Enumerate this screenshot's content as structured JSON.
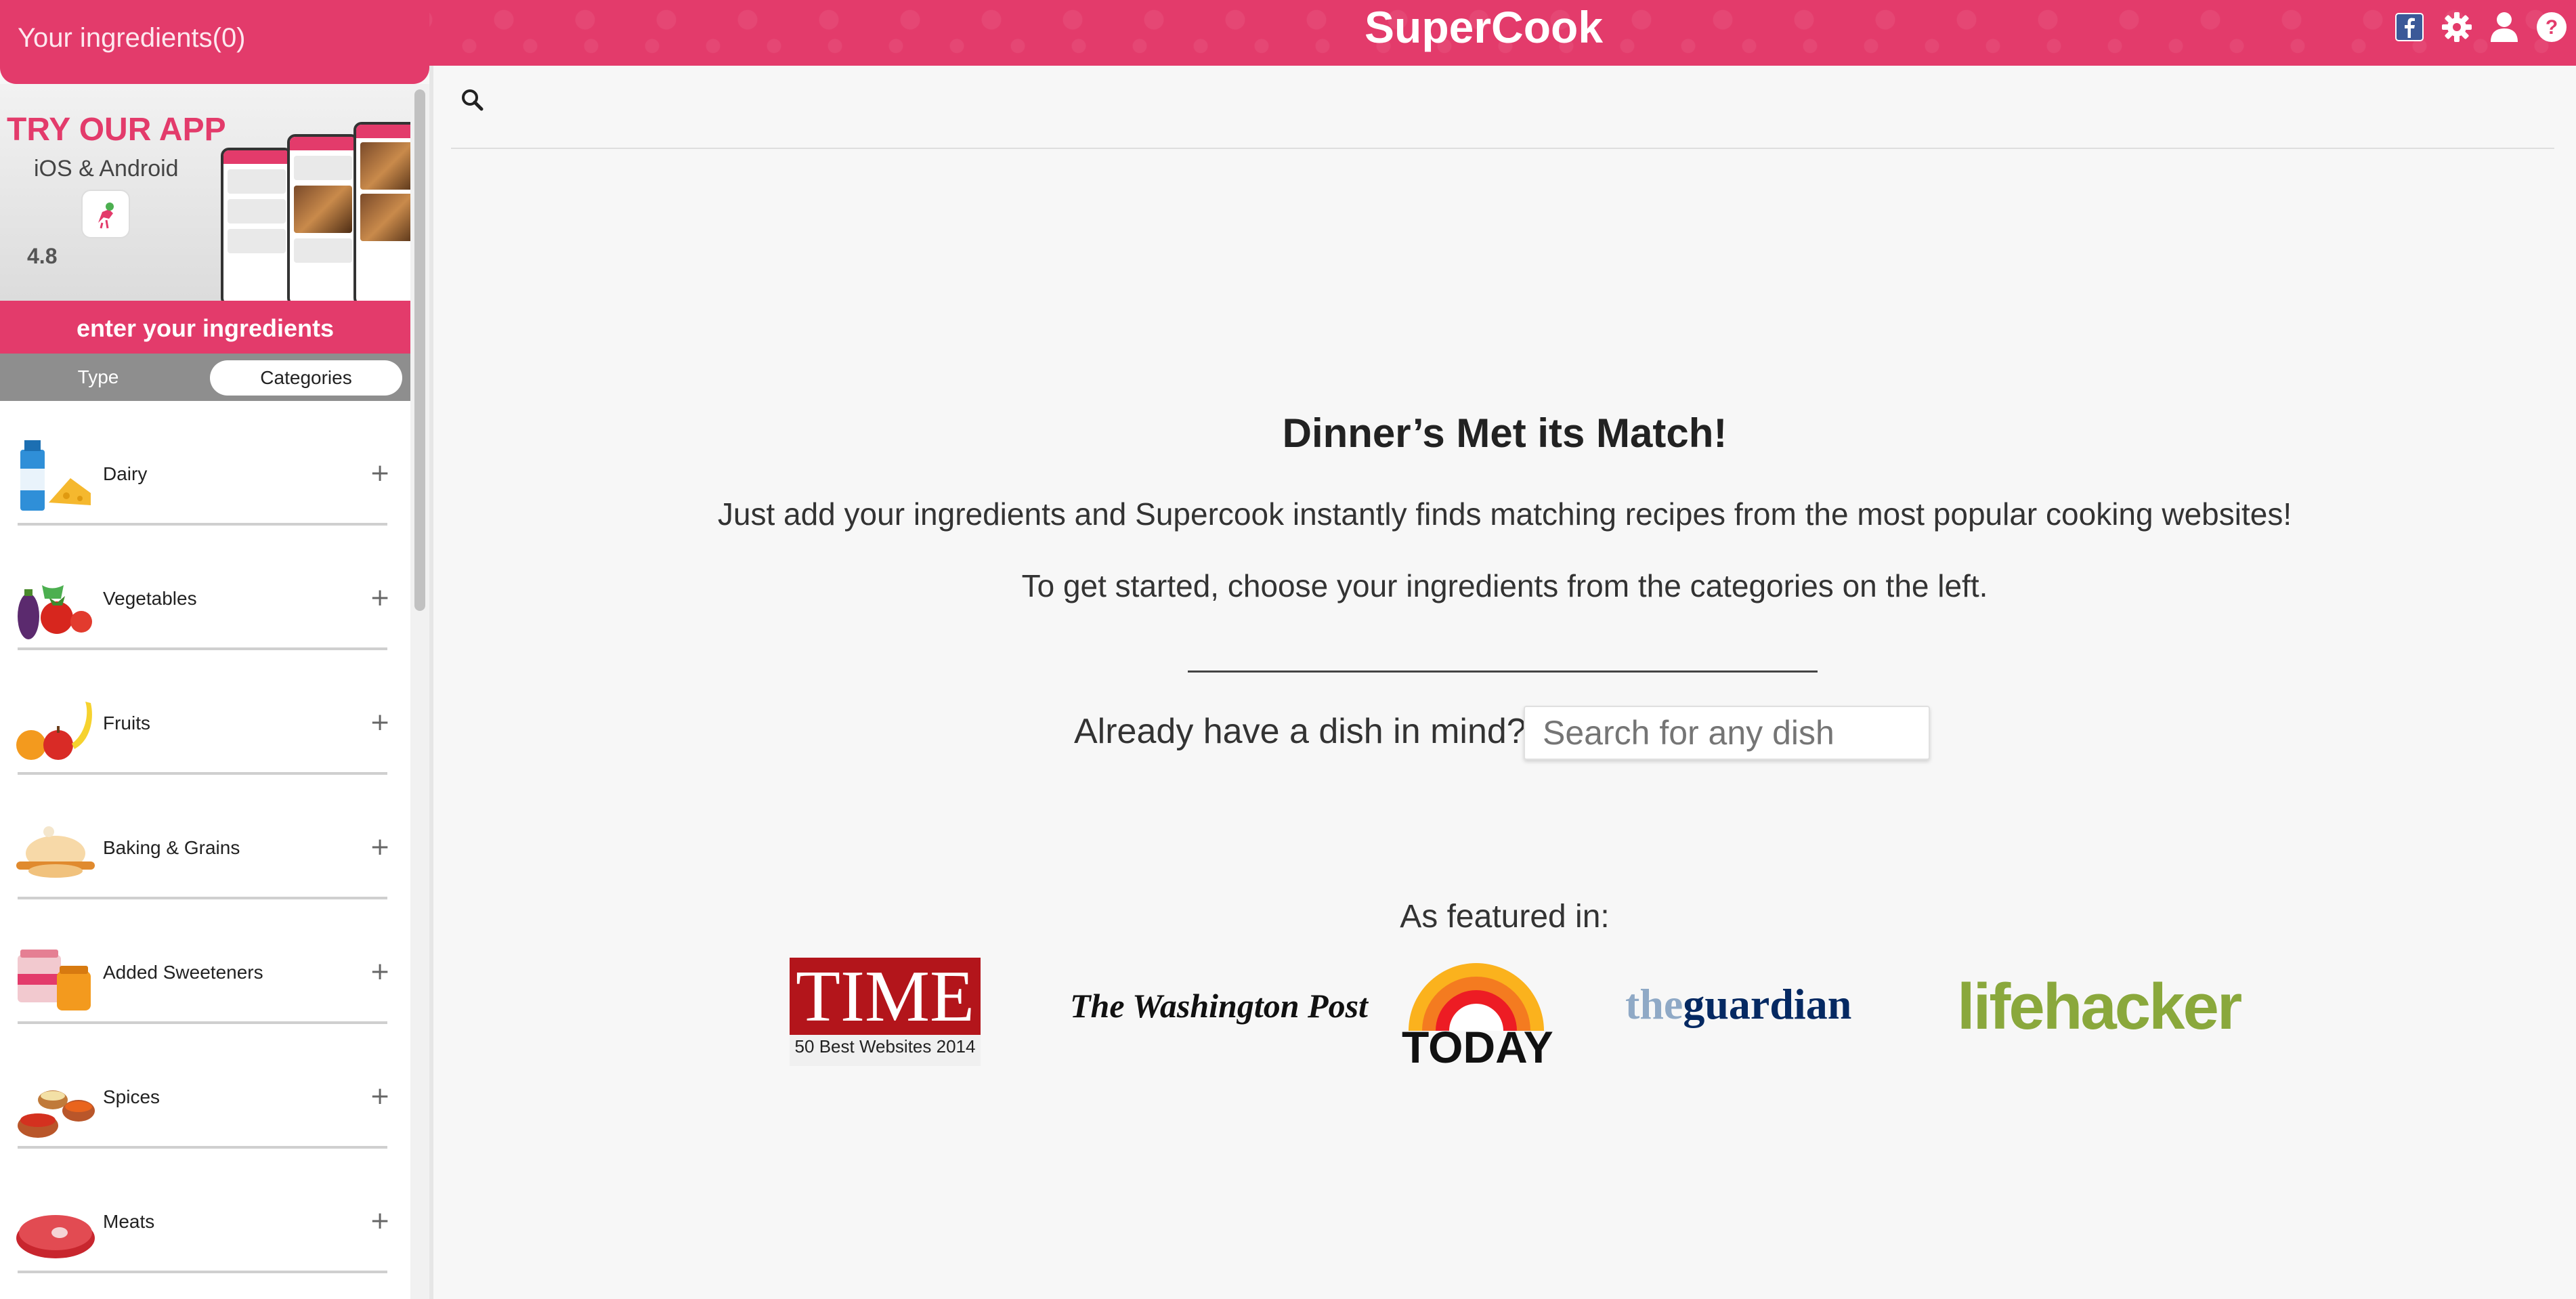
{
  "header": {
    "ingredients_title": "Your ingredients(0)",
    "brand": "SuperCook",
    "icons": [
      "facebook-icon",
      "gear-icon",
      "user-icon",
      "help-icon"
    ]
  },
  "sidebar": {
    "promo": {
      "title": "TRY OUR APP",
      "platforms": "iOS & Android",
      "rating": "4.8"
    },
    "enter_label": "enter your ingredients",
    "toggle": {
      "type": "Type",
      "categories": "Categories",
      "selected": "Categories"
    },
    "categories": [
      {
        "label": "Dairy",
        "icon": "dairy-icon"
      },
      {
        "label": "Vegetables",
        "icon": "vegetables-icon"
      },
      {
        "label": "Fruits",
        "icon": "fruits-icon"
      },
      {
        "label": "Baking & Grains",
        "icon": "baking-grains-icon"
      },
      {
        "label": "Added Sweeteners",
        "icon": "sweeteners-icon"
      },
      {
        "label": "Spices",
        "icon": "spices-icon"
      },
      {
        "label": "Meats",
        "icon": "meats-icon"
      }
    ]
  },
  "main": {
    "headline": "Dinner’s Met its Match!",
    "subtitle1": "Just add your ingredients and Supercook instantly finds matching recipes from the most popular cooking websites!",
    "subtitle2": "To get started, choose your ingredients from the categories on the left.",
    "dish_label": "Already have a dish in mind?",
    "dish_placeholder": "Search for any dish",
    "featured_label": "As featured in:",
    "logos": {
      "time": "TIME",
      "time_sub": "50 Best Websites 2014",
      "wapo": "The Washington Post",
      "today": "TODAY",
      "guardian_a": "the",
      "guardian_b": "guardian",
      "lifehacker": "lifehacker"
    }
  },
  "colors": {
    "brand": "#e33b6b",
    "time_red": "#b3151b",
    "guardian_blue": "#052962",
    "lifehacker_green": "#8aa83c"
  }
}
